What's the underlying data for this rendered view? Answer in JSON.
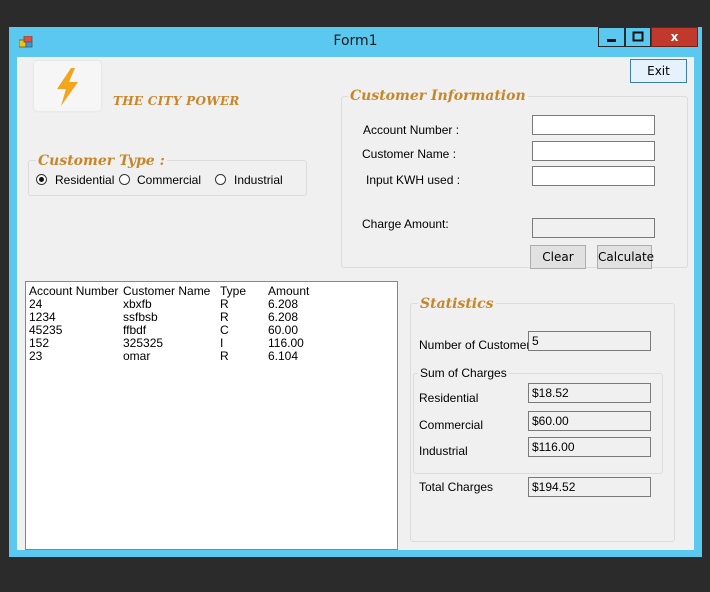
{
  "window": {
    "title": "Form1",
    "close_glyph": "x"
  },
  "header": {
    "exit_label": "Exit",
    "brand_title": "THE CITY POWER",
    "logo_icon": "lightning-bolt-icon"
  },
  "customer_type": {
    "legend": "Customer Type :",
    "options": [
      "Residential",
      "Commercial",
      "Industrial"
    ],
    "selected": "Residential"
  },
  "customer_info": {
    "legend": "Customer  Information",
    "account_number_label": "Account Number :",
    "customer_name_label": "Customer Name :",
    "kwh_label": "Input KWH used :",
    "charge_label": "Charge Amount:",
    "account_number_value": "",
    "customer_name_value": "",
    "kwh_value": "",
    "charge_value": "",
    "clear_label": "Clear",
    "calculate_label": "Calculate"
  },
  "list": {
    "headers": [
      "Account Number",
      "Customer Name",
      "Type",
      "Amount"
    ],
    "rows": [
      [
        "24",
        "xbxfb",
        "R",
        "6.208"
      ],
      [
        "1234",
        "ssfbsb",
        "R",
        "6.208"
      ],
      [
        "45235",
        "ffbdf",
        "C",
        "60.00"
      ],
      [
        "152",
        "325325",
        "I",
        "116.00"
      ],
      [
        "23",
        "omar",
        "R",
        "6.104"
      ]
    ]
  },
  "statistics": {
    "legend": "Statistics",
    "num_customers_label": "Number of Customers:",
    "num_customers_value": "5",
    "sum_legend": "Sum of Charges",
    "residential_label": "Residential",
    "residential_value": "$18.52",
    "commercial_label": "Commercial",
    "commercial_value": "$60.00",
    "industrial_label": "Industrial",
    "industrial_value": "$116.00",
    "total_label": "Total Charges",
    "total_value": "$194.52"
  },
  "colors": {
    "window_frame": "#5ac8ef",
    "close_button": "#c0392b",
    "accent_text": "#c8862a",
    "form_background": "#f0f0f0"
  }
}
